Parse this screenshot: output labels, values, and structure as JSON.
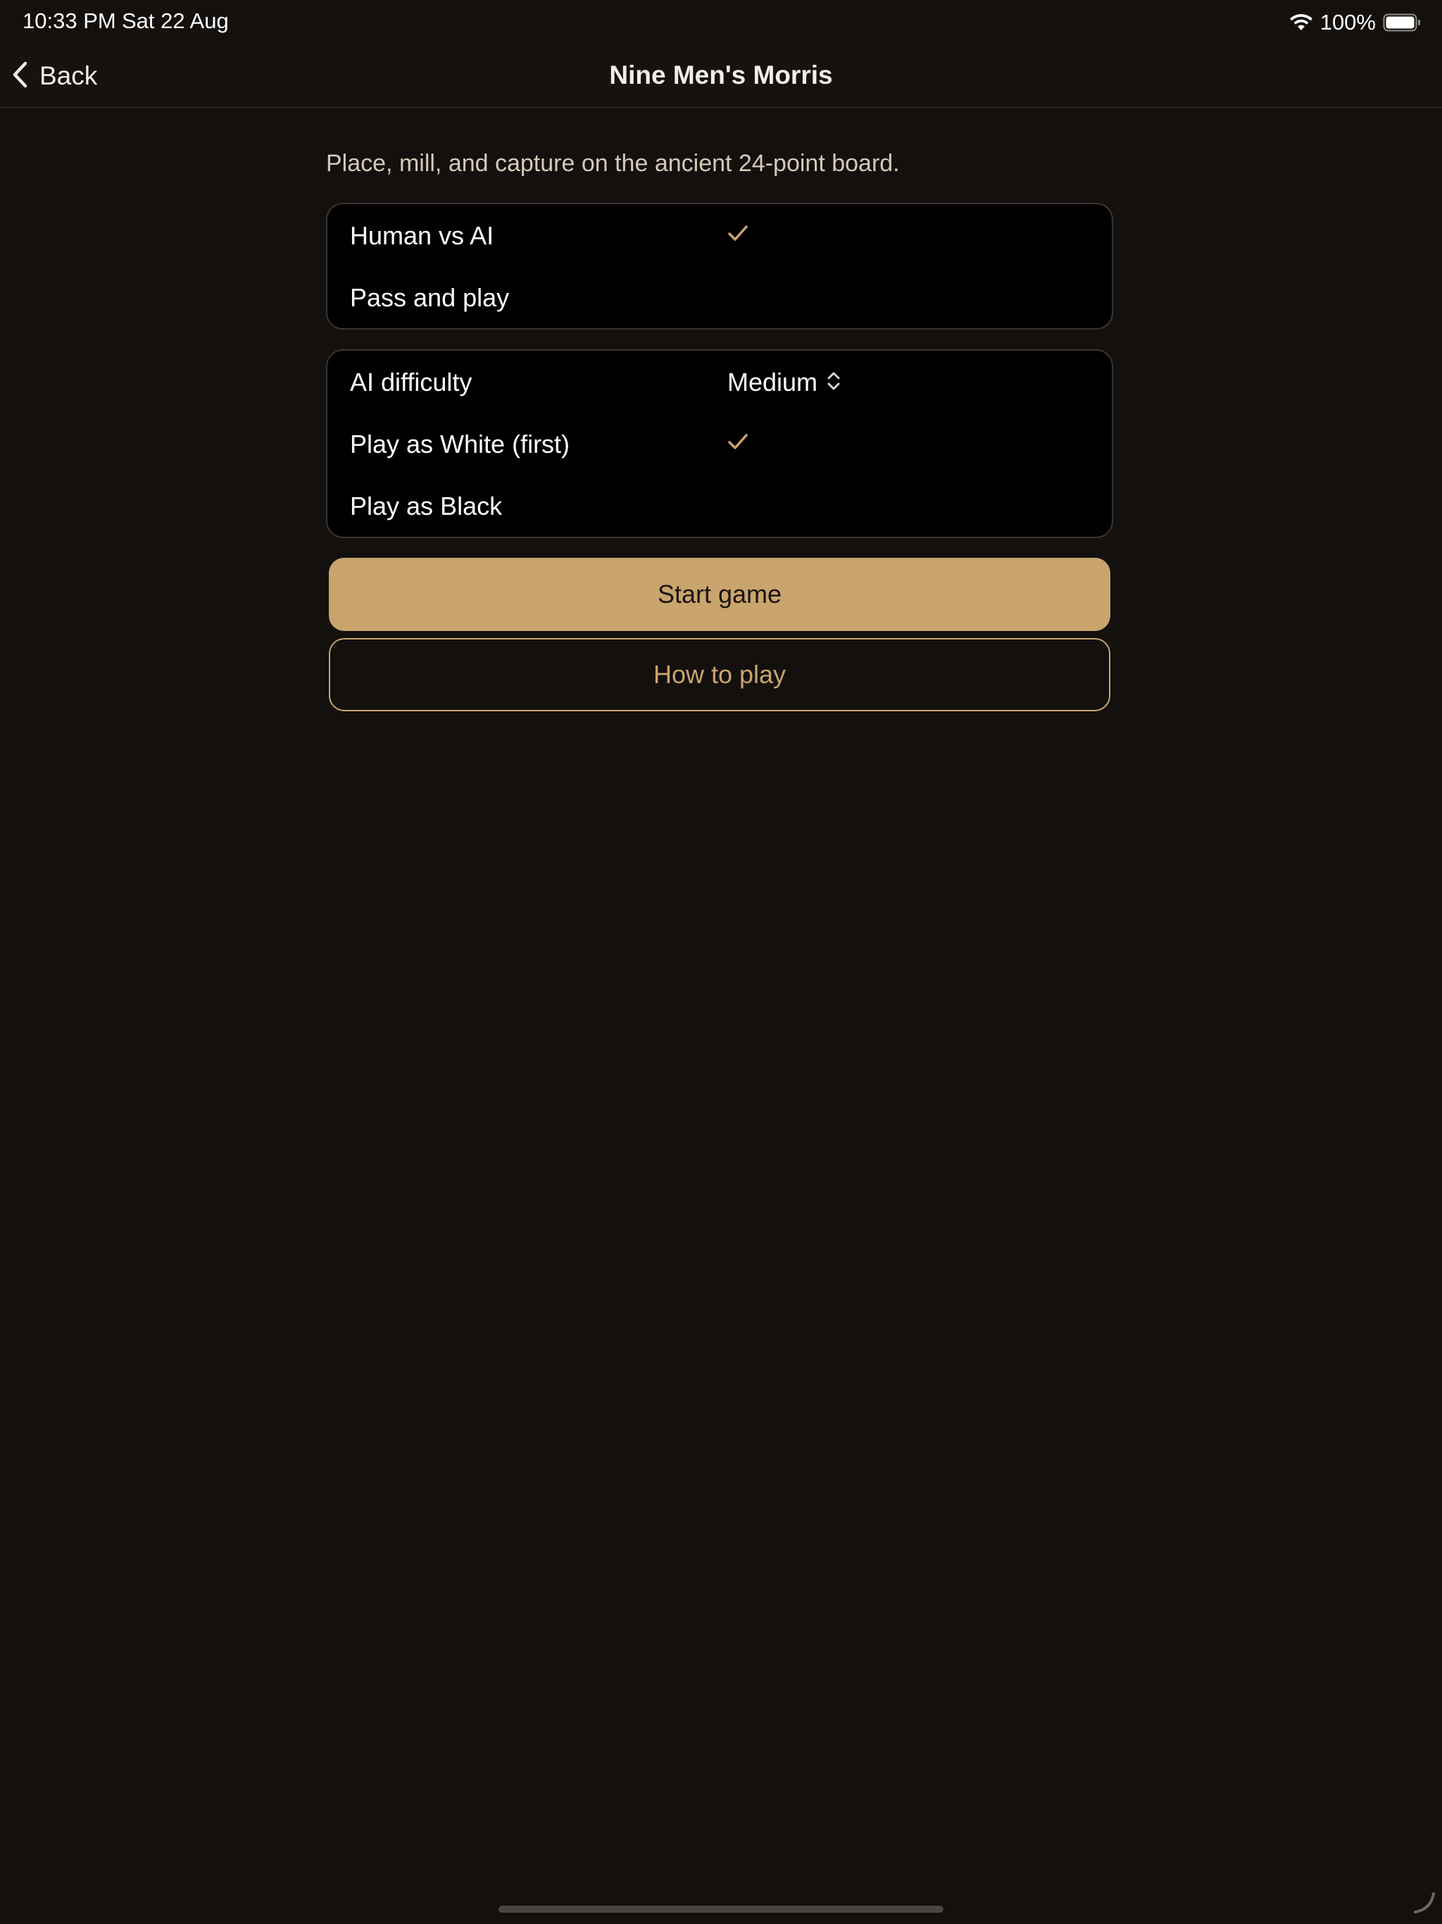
{
  "status_bar": {
    "time": "10:33 PM",
    "date": "Sat 22 Aug",
    "battery_percent": "100%",
    "icons": [
      "wifi-icon",
      "battery-icon"
    ]
  },
  "nav": {
    "back_label": "Back",
    "title": "Nine Men's Morris"
  },
  "subtitle": "Place, mill, and capture on the ancient 24-point board.",
  "mode_group": {
    "items": [
      {
        "label": "Human vs AI",
        "selected": true
      },
      {
        "label": "Pass and play",
        "selected": false
      }
    ]
  },
  "options_group": {
    "difficulty_label": "AI difficulty",
    "difficulty_value": "Medium",
    "side_items": [
      {
        "label": "Play as White (first)",
        "selected": true
      },
      {
        "label": "Play as Black",
        "selected": false
      }
    ]
  },
  "buttons": {
    "start": "Start game",
    "how_to_play": "How to play"
  },
  "colors": {
    "background": "#13100e",
    "accent": "#c9a46c",
    "card": "#000000"
  }
}
